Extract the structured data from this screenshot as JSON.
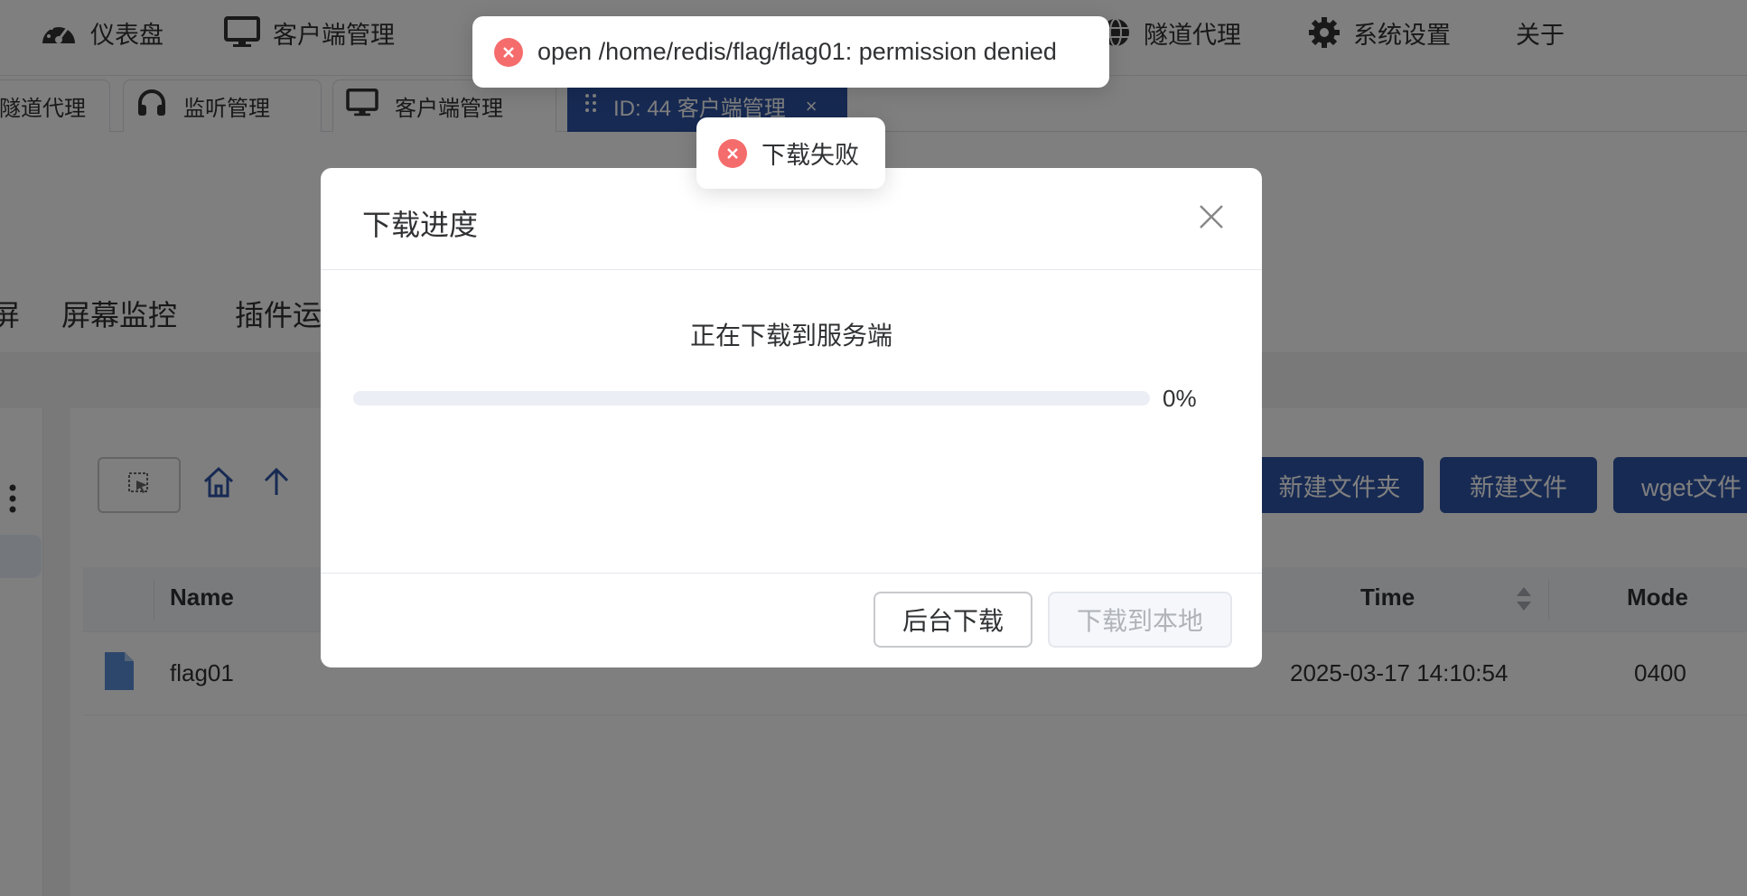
{
  "nav": {
    "items": [
      {
        "label": "仪表盘",
        "icon": "dashboard-gauge-icon"
      },
      {
        "label": "客户端管理",
        "icon": "monitor-icon"
      },
      {
        "label": "隧道代理",
        "icon": "globe-icon"
      },
      {
        "label": "系统设置",
        "icon": "gear-icon"
      },
      {
        "label": "关于"
      }
    ]
  },
  "tabs": {
    "items": [
      {
        "label": "隧道代理"
      },
      {
        "label": "监听管理",
        "icon": "headphones-icon"
      },
      {
        "label": "客户端管理",
        "icon": "monitor-icon"
      },
      {
        "label": "ID: 44 客户端管理",
        "close": "×",
        "active": true
      }
    ]
  },
  "function_tabs": {
    "items": [
      {
        "label": "屏幕监控"
      },
      {
        "label": "插件运"
      }
    ]
  },
  "file_manager": {
    "buttons": {
      "new_folder": "新建文件夹",
      "new_file": "新建文件",
      "wget": "wget文件"
    },
    "columns": {
      "name": "Name",
      "time": "Time",
      "mode": "Mode"
    },
    "rows": [
      {
        "name": "flag01",
        "time": "2025-03-17 14:10:54",
        "mode": "0400"
      }
    ]
  },
  "dialog": {
    "title": "下载进度",
    "status": "正在下载到服务端",
    "progress": 0,
    "progress_text": "0%",
    "background_button": "后台下载",
    "local_button": "下载到本地"
  },
  "toasts": [
    {
      "type": "error",
      "message": "open /home/redis/flag/flag01: permission denied"
    },
    {
      "type": "error",
      "message": "下载失败"
    }
  ],
  "colors": {
    "primary": "#2e55a7",
    "error": "#f56c6c",
    "overlay": "rgba(0,0,0,0.5)"
  }
}
